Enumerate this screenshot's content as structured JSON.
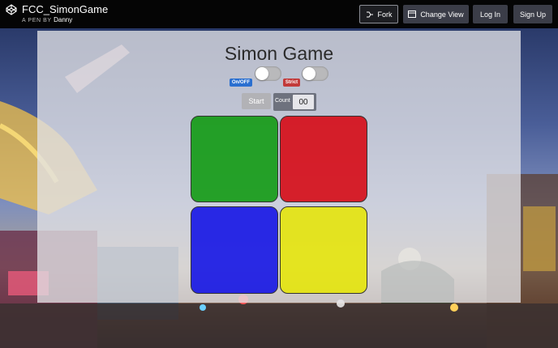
{
  "header": {
    "pen_title": "FCC_SimonGame",
    "byline_prefix": "A PEN BY",
    "author": "Danny",
    "buttons": {
      "fork": "Fork",
      "change_view": "Change View",
      "login": "Log In",
      "signup": "Sign Up"
    }
  },
  "game": {
    "title": "Simon Game",
    "power_label": "On/OFF",
    "strict_label": "Strict",
    "start_label": "Start",
    "count_label": "Count",
    "count_value": "00",
    "pads": {
      "green": "#009600",
      "red": "#d7000a",
      "blue": "#0a0ae6",
      "yellow": "#e6e600"
    }
  }
}
